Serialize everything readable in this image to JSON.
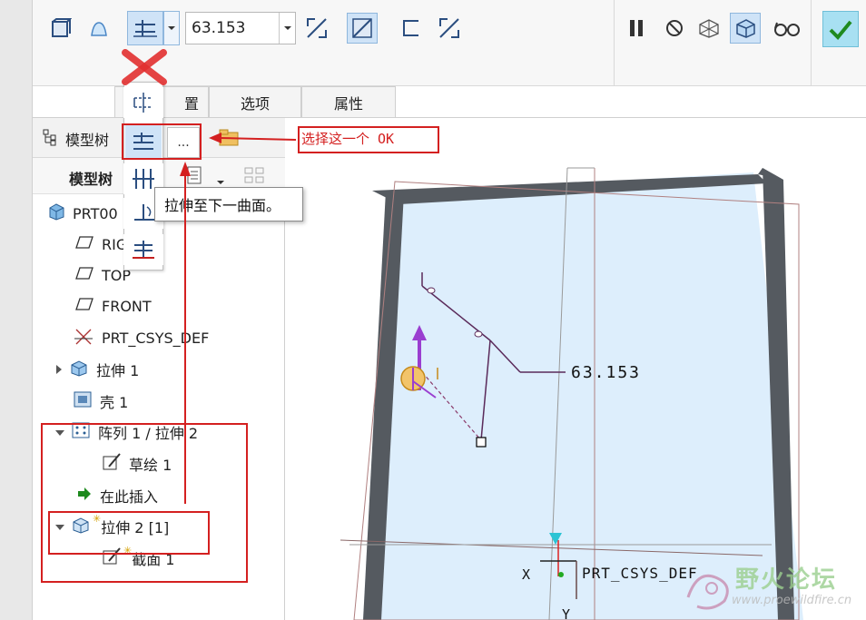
{
  "toolbar": {
    "depth_value": "63.153",
    "icons": [
      "solid-icon",
      "surface-icon",
      "depth-blind-icon",
      "dropdown-arrow-icon",
      "flip-direction-icon",
      "remove-material-icon",
      "thicken-icon",
      "flip-thicken-icon",
      "pause-icon",
      "no-preview-icon",
      "verify-mesh-icon",
      "preview-icon",
      "glasses-icon",
      "confirm-icon"
    ]
  },
  "tabs": [
    {
      "label": "置"
    },
    {
      "label": "选项"
    },
    {
      "label": "属性"
    }
  ],
  "flyout": {
    "items": [
      "symmetric-icon",
      "to-next-icon",
      "through-all-icon",
      "through-until-icon",
      "to-selected-icon"
    ],
    "more": "..."
  },
  "tooltip": {
    "text": "拉伸至下一曲面。"
  },
  "annotation": {
    "text": "选择这一个 OK"
  },
  "sidebar": {
    "header": "模型树",
    "subheader": "模型树",
    "items": [
      {
        "label": "PRT00",
        "indent": 0,
        "icon": "part-icon"
      },
      {
        "label": "RIG",
        "indent": 1,
        "icon": "datum-plane-icon"
      },
      {
        "label": "TOP",
        "indent": 1,
        "icon": "datum-plane-icon"
      },
      {
        "label": "FRONT",
        "indent": 1,
        "icon": "datum-plane-icon"
      },
      {
        "label": "PRT_CSYS_DEF",
        "indent": 1,
        "icon": "csys-icon"
      },
      {
        "label": "拉伸 1",
        "indent": 1,
        "icon": "extrude-icon"
      },
      {
        "label": "壳 1",
        "indent": 1,
        "icon": "shell-icon"
      },
      {
        "label": "阵列 1 / 拉伸 2",
        "indent": 1,
        "icon": "pattern-icon"
      },
      {
        "label": "草绘 1",
        "indent": 2,
        "icon": "sketch-icon"
      },
      {
        "label": "在此插入",
        "indent": 2,
        "icon": "insert-here-icon"
      },
      {
        "label": "拉伸 2 [1]",
        "indent": 1,
        "icon": "extrude-icon"
      },
      {
        "label": "截面 1",
        "indent": 2,
        "icon": "sketch-icon"
      }
    ]
  },
  "viewport": {
    "dimension": "63.153",
    "csys_label": "PRT_CSYS_DEF",
    "axis_x": "X",
    "axis_y": "Y"
  },
  "watermark": {
    "title": "野火论坛",
    "url": "www.proewildfire.cn"
  }
}
